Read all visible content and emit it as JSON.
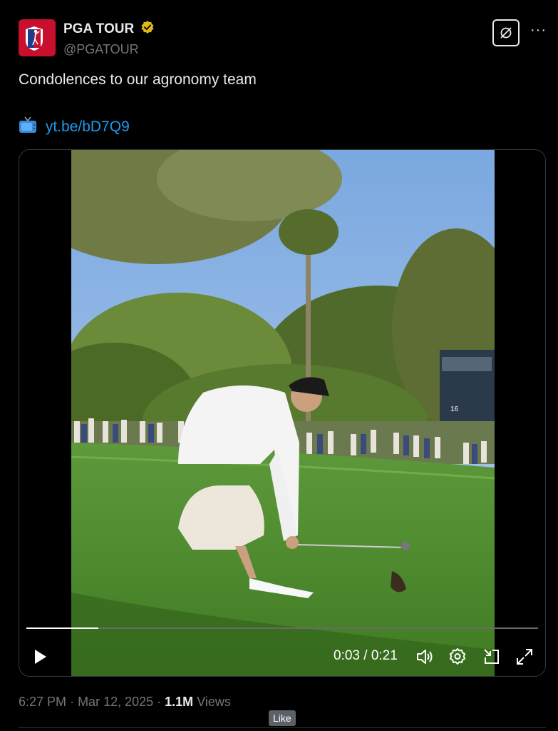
{
  "author": {
    "display_name": "PGA TOUR",
    "handle": "@PGATOUR",
    "verified": true,
    "avatar_icon": "pga-tour-logo-icon"
  },
  "actions": {
    "grok_icon": "grok-icon",
    "more_label": "···"
  },
  "tweet": {
    "text": "Condolences to our agronomy team",
    "link_emoji_icon": "tv-icon",
    "link_text": "yt.be/bD7Q9"
  },
  "video": {
    "time_display": "0:03 / 0:21",
    "progress": 0.14,
    "scene_sign_number": "16",
    "icons": [
      "play-icon",
      "volume-icon",
      "settings-icon",
      "dock-icon",
      "fullscreen-icon"
    ]
  },
  "meta": {
    "time": "6:27 PM",
    "date": "Mar 12, 2025",
    "views_count": "1.1M",
    "views_label": "Views"
  },
  "tooltip": {
    "label": "Like"
  },
  "colors": {
    "background": "#000000",
    "text": "#e7e9ea",
    "secondary": "#71767b",
    "link": "#1d9bf0",
    "brand_red": "#c8102e",
    "verified_gold": "#e2b719"
  }
}
